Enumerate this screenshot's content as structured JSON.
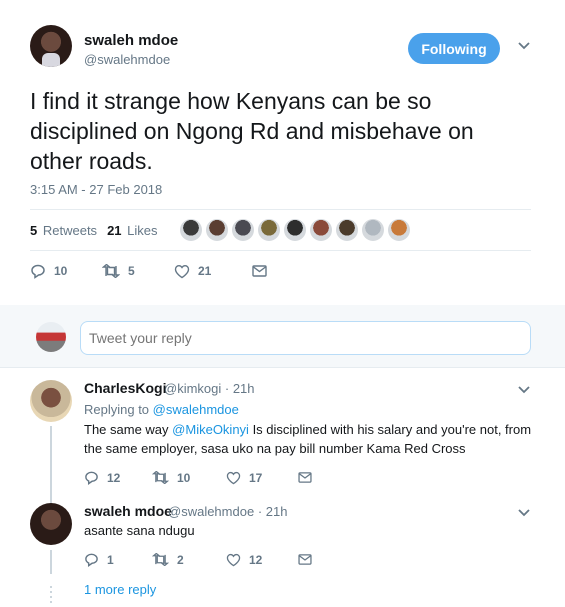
{
  "tweet": {
    "author_name": "swaleh mdoe",
    "author_handle": "@swalehmdoe",
    "follow_label": "Following",
    "text": "I find it strange how Kenyans can be so disciplined on Ngong Rd and misbehave on other roads.",
    "timestamp": "3:15 AM - 27 Feb 2018",
    "retweets_count": "5",
    "retweets_label": "Retweets",
    "likes_count": "21",
    "likes_label": "Likes",
    "likers": [
      "#3a3a3a",
      "#5a3e32",
      "#4a4a52",
      "#7a6a3a",
      "#2d2d2d",
      "#8a4a3a",
      "#4b3b2b",
      "#b0b8c0",
      "#c87a3a"
    ],
    "actions": {
      "replies": "10",
      "retweets": "5",
      "likes": "21"
    }
  },
  "compose": {
    "placeholder": "Tweet your reply"
  },
  "replies": [
    {
      "author_name": "CharlesKogi",
      "author_handle": "@kimkogi",
      "time": "· 21h",
      "replying_prefix": "Replying to",
      "replying_to": "@swalehmdoe",
      "text_before_mention": "The same way",
      "mention": "@MikeOkinyi",
      "text_after_mention": "Is disciplined with his salary and you're not, from",
      "text_line2": "the same employer, sasa uko na pay bill number Kama Red Cross",
      "replies": "12",
      "retweets": "10",
      "likes": "17"
    },
    {
      "author_name": "swaleh mdoe",
      "author_handle": "@swalehmdoe",
      "time": "· 21h",
      "text": "asante sana ndugu",
      "replies": "1",
      "retweets": "2",
      "likes": "12"
    }
  ],
  "more_replies": "1 more reply"
}
